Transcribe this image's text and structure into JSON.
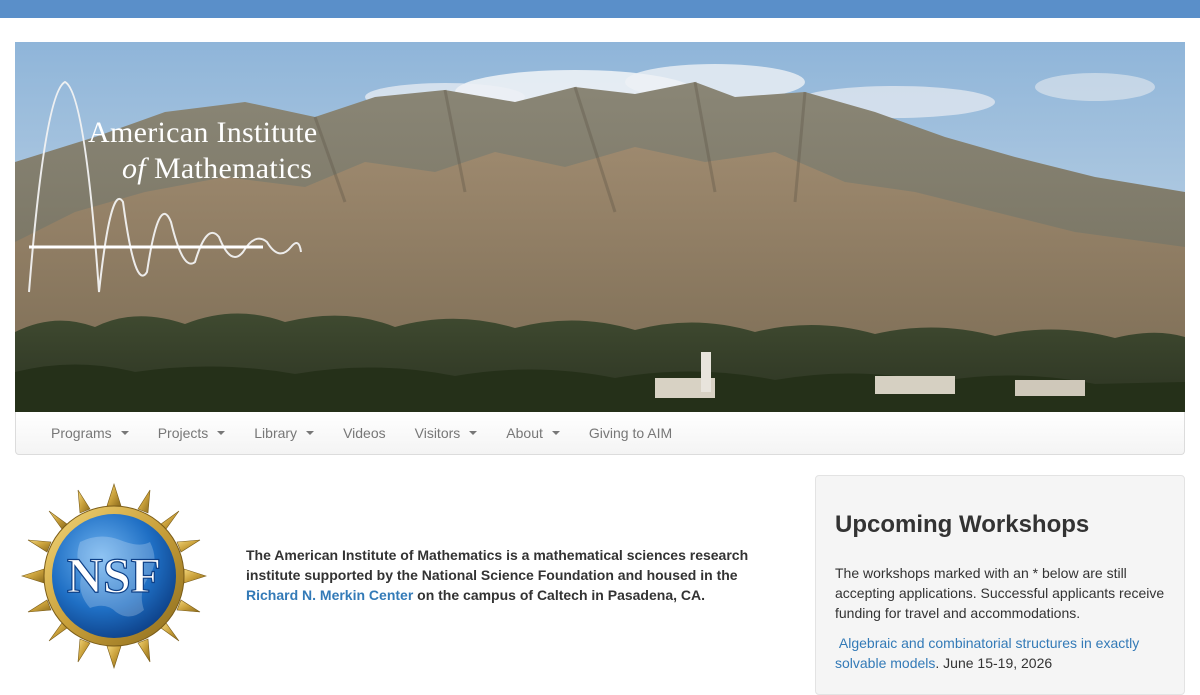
{
  "hero": {
    "logo_line1": "American Institute",
    "logo_of": "of",
    "logo_line2": "Mathematics"
  },
  "nav": {
    "items": [
      {
        "label": "Programs",
        "dropdown": true
      },
      {
        "label": "Projects",
        "dropdown": true
      },
      {
        "label": "Library",
        "dropdown": true
      },
      {
        "label": "Videos",
        "dropdown": false
      },
      {
        "label": "Visitors",
        "dropdown": true
      },
      {
        "label": "About",
        "dropdown": true
      },
      {
        "label": "Giving to AIM",
        "dropdown": false
      }
    ]
  },
  "nsf": {
    "letters": "NSF"
  },
  "intro": {
    "text_before": "The American Institute of Mathematics is a mathematical sciences research institute supported by the National Science Foundation and housed in the",
    "link": "Richard N. Merkin Center",
    "text_after": "on the campus of Caltech in Pasadena, CA."
  },
  "sidebar": {
    "title": "Upcoming Workshops",
    "note": "The workshops marked with an * below are still accepting applications. Successful applicants receive funding for travel and accommodations.",
    "workshops": [
      {
        "title": "Algebraic and combinatorial structures in exactly solvable models",
        "dates": ". June 15-19, 2026"
      }
    ]
  },
  "colors": {
    "top_bar": "#5a8fc9",
    "link": "#337ab7",
    "nav_text": "#777777"
  }
}
